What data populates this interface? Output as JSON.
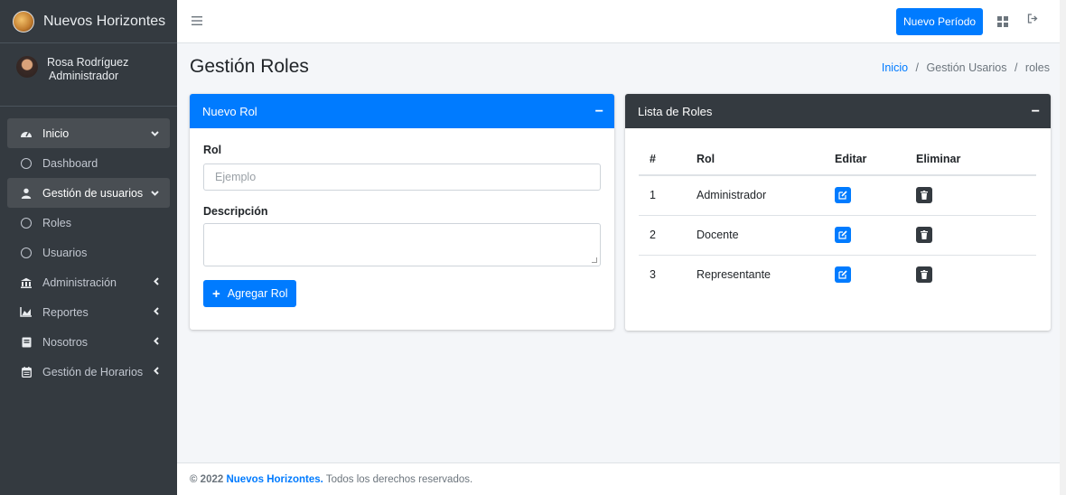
{
  "brand": {
    "name": "Nuevos Horizontes"
  },
  "user": {
    "name": "Rosa Rodríguez",
    "role": "Administrador"
  },
  "sidebar": {
    "items": [
      {
        "label": "Inicio",
        "icon": "dashboard-gauge-icon",
        "chevron": "⌄",
        "open": true
      },
      {
        "label": "Dashboard",
        "icon": "circle-outline-icon",
        "sub": true
      },
      {
        "label": "Gestión de usuarios",
        "icon": "user-icon",
        "chevron": "⌄",
        "open": true
      },
      {
        "label": "Roles",
        "icon": "circle-outline-icon",
        "sub": true
      },
      {
        "label": "Usuarios",
        "icon": "circle-outline-icon",
        "sub": true
      },
      {
        "label": "Administración",
        "icon": "building-icon",
        "chevron": "‹"
      },
      {
        "label": "Reportes",
        "icon": "chart-area-icon",
        "chevron": "‹"
      },
      {
        "label": "Nosotros",
        "icon": "book-icon",
        "chevron": "‹"
      },
      {
        "label": "Gestión de Horarios",
        "icon": "calendar-icon",
        "chevron": "‹"
      }
    ]
  },
  "navbar": {
    "new_period_label": "Nuevo Período"
  },
  "header": {
    "title": "Gestión Roles",
    "breadcrumb": {
      "home": "Inicio",
      "sep": "/",
      "section": "Gestión Usarios",
      "page": "roles"
    }
  },
  "form_card": {
    "title": "Nuevo Rol",
    "collapse": "−",
    "rol_label": "Rol",
    "rol_placeholder": "Ejemplo",
    "rol_value": "",
    "desc_label": "Descripción",
    "desc_value": "",
    "submit_label": "Agregar Rol"
  },
  "list_card": {
    "title": "Lista de Roles",
    "collapse": "−",
    "columns": [
      "#",
      "Rol",
      "Editar",
      "Eliminar"
    ],
    "rows": [
      {
        "num": "1",
        "rol": "Administrador"
      },
      {
        "num": "2",
        "rol": "Docente"
      },
      {
        "num": "3",
        "rol": "Representante"
      }
    ]
  },
  "footer": {
    "copyright": "© 2022",
    "brand": "Nuevos Horizontes.",
    "rights": "Todos los derechos reservados."
  },
  "colors": {
    "primary": "#007bff",
    "dark": "#343a40",
    "sidebar": "#343a40",
    "background": "#f4f6f9"
  }
}
